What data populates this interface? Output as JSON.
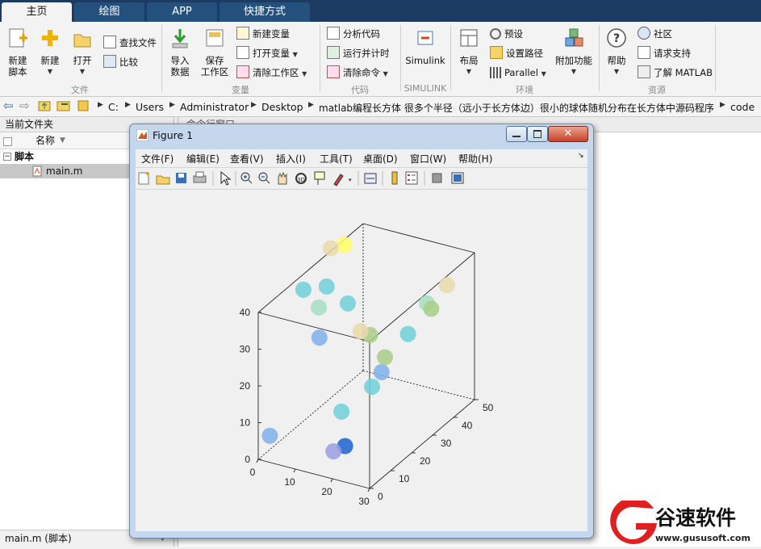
{
  "tabs": [
    "主页",
    "绘图",
    "APP",
    "快捷方式"
  ],
  "ribbon": {
    "file": {
      "new_script": "新建\n脚本",
      "new": "新建",
      "open": "打开",
      "find_files": "查找文件",
      "compare": "比较",
      "group": "文件"
    },
    "variable": {
      "import": "导入\n数据",
      "save_ws": "保存\n工作区",
      "new_var": "新建变量",
      "open_var": "打开变量",
      "clear_ws": "清除工作区",
      "group": "变量"
    },
    "code": {
      "analyze": "分析代码",
      "run_time": "运行并计时",
      "clear_cmds": "清除命令",
      "group": "代码"
    },
    "simulink": {
      "label": "Simulink",
      "group": "SIMULINK"
    },
    "environment": {
      "layout": "布局",
      "prefs": "预设",
      "set_path": "设置路径",
      "parallel": "Parallel",
      "addons": "附加功能",
      "group": "环境"
    },
    "resources": {
      "help": "帮助",
      "community": "社区",
      "support": "请求支持",
      "learn": "了解 MATLAB",
      "group": "资源"
    }
  },
  "address": {
    "path": [
      "C:",
      "Users",
      "Administrator",
      "Desktop",
      "matlab编程长方体 很多个半径（远小于长方体边）很小的球体随机分布在长方体中源码程序",
      "code"
    ]
  },
  "left_panel": {
    "title": "当前文件夹",
    "col_name": "名称",
    "group": "脚本",
    "file": "main.m",
    "footer": "main.m  (脚本)"
  },
  "command_window": {
    "title": "命令行窗口"
  },
  "figure": {
    "title": "Figure 1",
    "menu": [
      "文件(F)",
      "编辑(E)",
      "查看(V)",
      "插入(I)",
      "工具(T)",
      "桌面(D)",
      "窗口(W)",
      "帮助(H)"
    ],
    "icons": [
      "new-figure-icon",
      "open-file-icon",
      "save-icon",
      "print-icon",
      "arrow-select-icon",
      "zoom-in-icon",
      "zoom-out-icon",
      "pan-hand-icon",
      "rotate-3d-icon",
      "data-cursor-icon",
      "brush-icon",
      "link-plot-icon",
      "colorbar-icon",
      "legend-icon",
      "hide-plot-tools-icon",
      "show-plot-tools-icon"
    ]
  },
  "chart_data": {
    "type": "scatter",
    "view": "3d",
    "title": "",
    "xlabel": "",
    "ylabel": "",
    "zlabel": "",
    "xlim": [
      0,
      30
    ],
    "ylim": [
      0,
      50
    ],
    "zlim": [
      0,
      40
    ],
    "xticks": [
      0,
      10,
      20,
      30
    ],
    "yticks": [
      0,
      10,
      20,
      30,
      40,
      50
    ],
    "zticks": [
      0,
      10,
      20,
      30,
      40
    ],
    "grid": false,
    "marker_colors": [
      "#7fb0ea",
      "#6fd0d8",
      "#a7dec3",
      "#ead9a9",
      "#ffff66",
      "#a8cc88",
      "#1b62d0",
      "#9a9ee0"
    ],
    "points": [
      {
        "x": 2,
        "y": 2,
        "z": 6,
        "c": 0
      },
      {
        "x": 18,
        "y": 4,
        "z": 5,
        "c": 7
      },
      {
        "x": 20,
        "y": 6,
        "z": 6,
        "c": 6
      },
      {
        "x": 10,
        "y": 22,
        "z": 5,
        "c": 1
      },
      {
        "x": 12,
        "y": 33,
        "z": 7,
        "c": 1
      },
      {
        "x": 14,
        "y": 34,
        "z": 11,
        "c": 0
      },
      {
        "x": 20,
        "y": 25,
        "z": 21,
        "c": 5
      },
      {
        "x": 8,
        "y": 15,
        "z": 28,
        "c": 0
      },
      {
        "x": 14,
        "y": 24,
        "z": 27,
        "c": 3
      },
      {
        "x": 16,
        "y": 25,
        "z": 26,
        "c": 5
      },
      {
        "x": 20,
        "y": 36,
        "z": 22,
        "c": 1
      },
      {
        "x": 5,
        "y": 20,
        "z": 33,
        "c": 2
      },
      {
        "x": 2,
        "y": 18,
        "z": 38,
        "c": 1
      },
      {
        "x": 6,
        "y": 22,
        "z": 38,
        "c": 1
      },
      {
        "x": 10,
        "y": 25,
        "z": 33,
        "c": 1
      },
      {
        "x": 24,
        "y": 40,
        "z": 28,
        "c": 5
      },
      {
        "x": 20,
        "y": 45,
        "z": 26,
        "c": 2
      },
      {
        "x": 26,
        "y": 44,
        "z": 33,
        "c": 3
      },
      {
        "x": 2,
        "y": 31,
        "z": 43,
        "c": 3
      },
      {
        "x": 4,
        "y": 34,
        "z": 43,
        "c": 4
      }
    ]
  }
}
